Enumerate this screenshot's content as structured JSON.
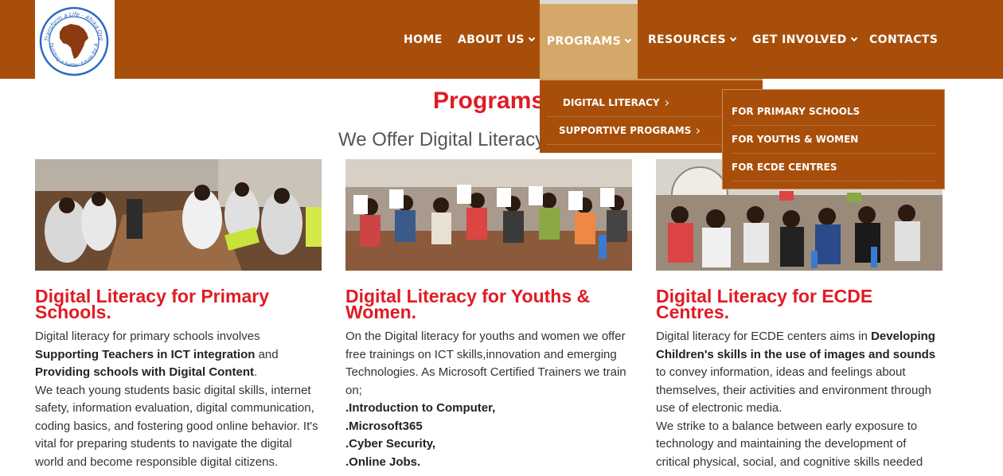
{
  "header": {
    "logo": {
      "ring_text_top": "Transform a Life - Afrika Org",
      "ring_text_bottom": "building a better future for Africa"
    },
    "nav": [
      {
        "label": "HOME",
        "has_dropdown": false
      },
      {
        "label": "ABOUT US",
        "has_dropdown": true
      },
      {
        "label": "PROGRAMS",
        "has_dropdown": true,
        "active": true
      },
      {
        "label": "RESOURCES",
        "has_dropdown": true
      },
      {
        "label": "GET INVOLVED",
        "has_dropdown": true
      },
      {
        "label": "CONTACTS",
        "has_dropdown": false
      }
    ]
  },
  "programs_menu": {
    "items": [
      {
        "label": "DIGITAL LITERACY"
      },
      {
        "label": "SUPPORTIVE PROGRAMS"
      }
    ],
    "submenu": [
      {
        "label": "FOR PRIMARY SCHOOLS"
      },
      {
        "label": "FOR YOUTHS & WOMEN"
      },
      {
        "label": "FOR ECDE CENTRES"
      }
    ]
  },
  "main": {
    "title": "Programs",
    "subtitle": "We Offer Digital Literacy"
  },
  "cards": [
    {
      "title": "Digital Literacy for Primary Schools.",
      "p1": "Digital literacy for primary schools involves",
      "b1": "Supporting Teachers in ICT integration",
      "and": " and",
      "b2": "Providing schools with Digital Content",
      "dot": ".",
      "p2": "We teach young students basic digital skills, internet safety, information evaluation, digital communication, coding basics, and fostering good online behavior. It's vital for preparing students to navigate the digital world and become responsible digital citizens."
    },
    {
      "title": "Digital Literacy for Youths & Women.",
      "p1": "On the Digital literacy for youths and women we offer free trainings on ICT skills,innovation and emerging Technologies. As Microsoft Certified Trainers we train on;",
      "list": [
        ".Introduction to Computer,",
        ".Microsoft365",
        ".Cyber Security,",
        ".Online Jobs."
      ]
    },
    {
      "title": "Digital Literacy for ECDE Centres.",
      "p1": "Digital literacy for ECDE centers aims in",
      "b1": "Developing Children's skills in the use of images and sounds",
      "p1b": "to convey information, ideas and feelings about themselves, their activities and environment through use of electronic media.",
      "p2": "We strike to a balance between early exposure to technology and maintaining the development of critical physical, social, and cognitive skills needed"
    }
  ],
  "colors": {
    "header_bg": "#a84e0b",
    "active_nav_bg": "#d4a868",
    "accent_red": "#e01b24",
    "subtitle_gray": "#555555"
  }
}
